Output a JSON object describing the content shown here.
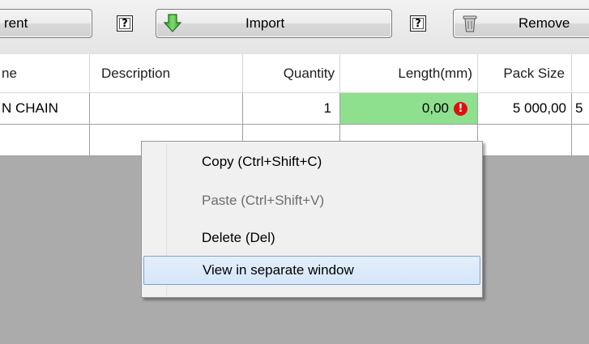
{
  "toolbar": {
    "buttons": [
      {
        "label": "rent",
        "icon": "window-frame-icon"
      },
      {
        "label": "Import",
        "icon": "green-down-arrow-icon"
      },
      {
        "label": "Remove",
        "icon": "trash-bin-icon"
      }
    ],
    "help_glyph": "?"
  },
  "table": {
    "columns": [
      "ne",
      "Description",
      "Quantity",
      "Length(mm)",
      "Pack Size",
      ""
    ],
    "rows": [
      {
        "name": "N CHAIN",
        "description": "",
        "quantity": "1",
        "length": "0,00",
        "pack_size": "5 000,00",
        "extra": "5"
      }
    ],
    "error_glyph": "!"
  },
  "context_menu": {
    "items": [
      {
        "label": "Copy (Ctrl+Shift+C)",
        "enabled": true
      },
      {
        "label": "Paste (Ctrl+Shift+V)",
        "enabled": false
      },
      {
        "label": "Delete (Del)",
        "enabled": true
      },
      {
        "label": "View in separate window",
        "enabled": true,
        "highlighted": true
      }
    ]
  },
  "colors": {
    "invalid_cell": "#8ee08e",
    "error_badge": "#e01010",
    "menu_highlight_border": "#7da2ce",
    "background": "#ababab"
  }
}
